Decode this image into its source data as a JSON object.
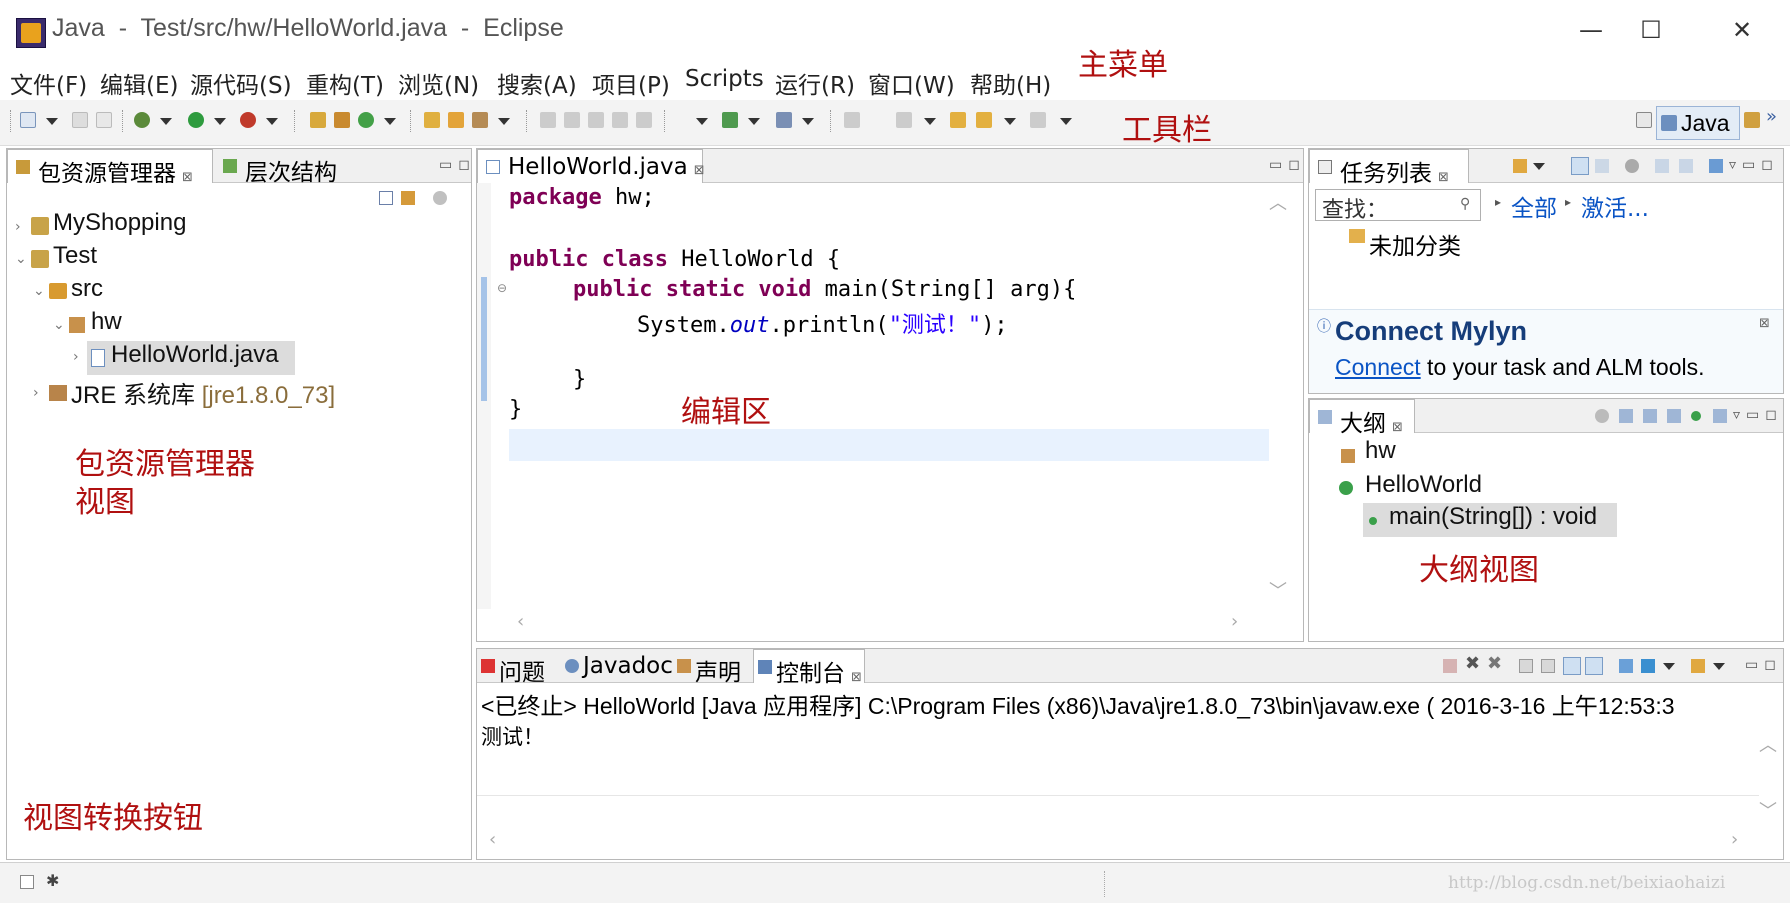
{
  "window": {
    "title": "Java  -  Test/src/hw/HelloWorld.java  -  Eclipse",
    "minimize": "—",
    "maximize": "☐",
    "close": "✕"
  },
  "menu": {
    "items": [
      "文件(F)",
      "编辑(E)",
      "源代码(S)",
      "重构(T)",
      "浏览(N)",
      "搜索(A)",
      "项目(P)",
      "Scripts",
      "运行(R)",
      "窗口(W)",
      "帮助(H)"
    ]
  },
  "perspective": {
    "label": "Java"
  },
  "package_explorer": {
    "tabs": [
      {
        "label": "包资源管理器"
      },
      {
        "label": "层次结构"
      }
    ],
    "tree": [
      {
        "label": "MyShopping"
      },
      {
        "label": "Test"
      },
      {
        "label": "src"
      },
      {
        "label": "hw"
      },
      {
        "label": "HelloWorld.java"
      },
      {
        "label": "JRE 系统库",
        "suffix": "[jre1.8.0_73]"
      }
    ]
  },
  "editor": {
    "tab_label": "HelloWorld.java",
    "code": {
      "l1_kw": "package",
      "l1_rest": " hw;",
      "l3_kw": "public class",
      "l3_rest": " HelloWorld {",
      "l4_kw": "public static void",
      "l4_rest": " main(String[] arg){",
      "l5_a": "System.",
      "l5_b": "out",
      "l5_c": ".println(",
      "l5_str": "\"测试！\"",
      "l5_d": ");",
      "l7": "}",
      "l8": "}"
    }
  },
  "task_list": {
    "tab_label": "任务列表",
    "search_placeholder": "查找：",
    "filter_all": "全部",
    "filter_activate": "激活...",
    "uncategorized": "未加分类"
  },
  "mylyn": {
    "title": "Connect Mylyn",
    "link": "Connect",
    "text": " to your task and ALM tools."
  },
  "outline": {
    "tab_label": "大纲",
    "items": [
      {
        "label": "hw"
      },
      {
        "label": "HelloWorld"
      },
      {
        "label": "main(String[]) : void"
      }
    ]
  },
  "console": {
    "tabs": [
      {
        "label": "问题"
      },
      {
        "label": "Javadoc"
      },
      {
        "label": "声明"
      },
      {
        "label": "控制台"
      }
    ],
    "header": "<已终止> HelloWorld [Java 应用程序] C:\\Program Files (x86)\\Java\\jre1.8.0_73\\bin\\javaw.exe ( 2016-3-16 上午12:53:3",
    "output": "测试！"
  },
  "annotations": {
    "main_menu": "主菜单",
    "toolbar": "工具栏",
    "package_explorer_view_1": "包资源管理器",
    "package_explorer_view_2": "视图",
    "editor_area": "编辑区",
    "outline_view": "大纲视图",
    "view_switch_button": "视图转换按钮"
  },
  "watermark": "http://blog.csdn.net/beixiaohaizi",
  "colors": {
    "keyword": "#7f0055",
    "string": "#2a00ff",
    "field": "#0000c0",
    "annotation": "#b01010",
    "link": "#0a54c5",
    "jre_suffix": "#8a6d3b"
  }
}
